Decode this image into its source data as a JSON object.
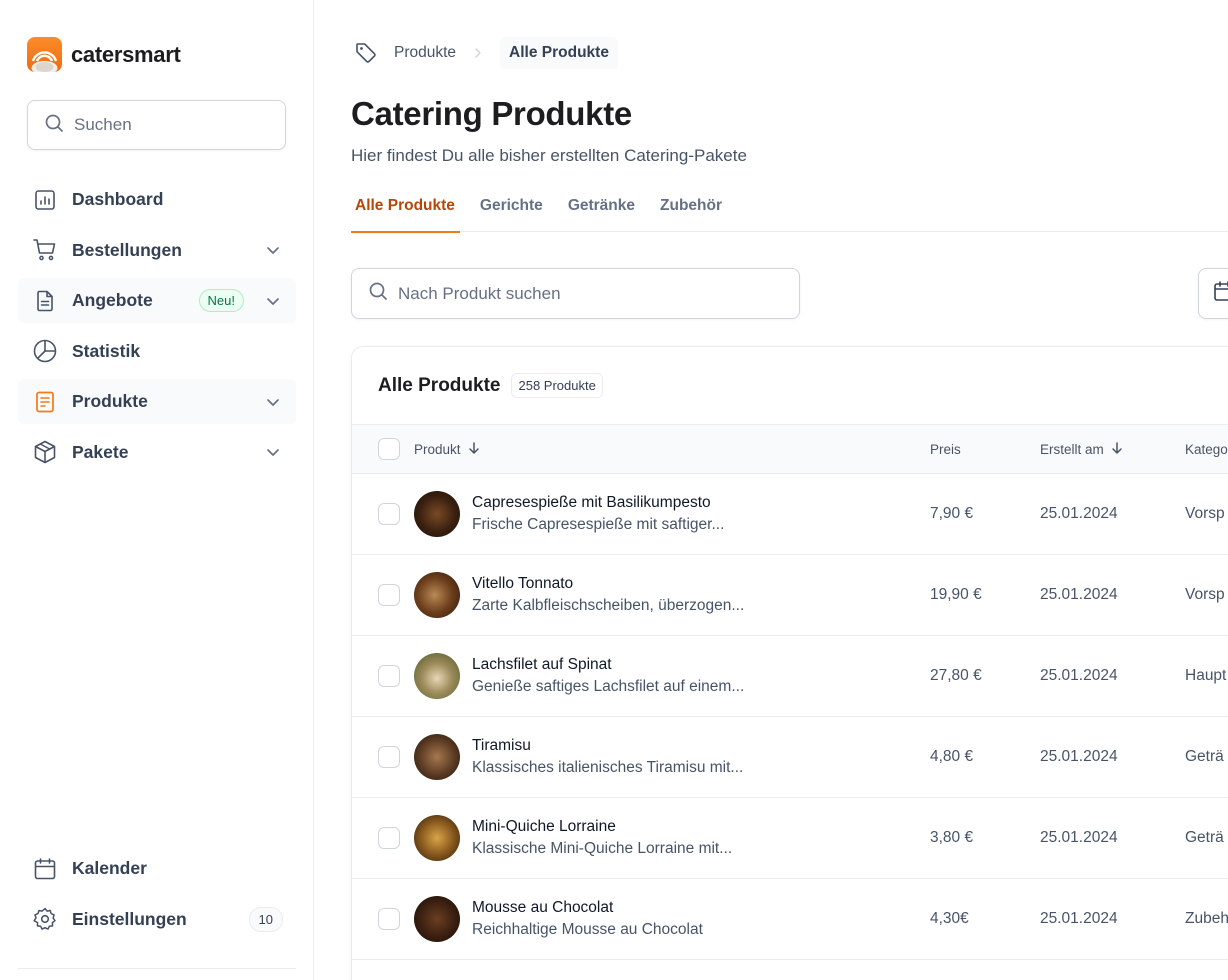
{
  "app": {
    "name": "catersmart"
  },
  "sidebar": {
    "search_placeholder": "Suchen",
    "items": [
      {
        "label": "Dashboard",
        "icon": "chart-bar-icon"
      },
      {
        "label": "Bestellungen",
        "icon": "cart-icon"
      },
      {
        "label": "Angebote",
        "icon": "document-icon",
        "badge": "Neu!"
      },
      {
        "label": "Statistik",
        "icon": "pie-chart-icon"
      },
      {
        "label": "Produkte",
        "icon": "product-doc-icon"
      },
      {
        "label": "Pakete",
        "icon": "package-icon"
      }
    ],
    "bottom_items": [
      {
        "label": "Kalender",
        "icon": "calendar-icon"
      },
      {
        "label": "Einstellungen",
        "icon": "gear-icon",
        "count": "10"
      }
    ]
  },
  "breadcrumb": {
    "parent": "Produkte",
    "current": "Alle Produkte"
  },
  "page": {
    "title": "Catering Produkte",
    "subtitle": "Hier findest Du alle bisher erstellten Catering-Pakete"
  },
  "tabs": [
    "Alle Produkte",
    "Gerichte",
    "Getränke",
    "Zubehör"
  ],
  "product_search": {
    "placeholder": "Nach Produkt suchen"
  },
  "table": {
    "title": "Alle Produkte",
    "count": "258 Produkte",
    "columns": {
      "product": "Produkt",
      "price": "Preis",
      "created": "Erstellt am",
      "category": "Katego"
    },
    "rows": [
      {
        "name": "Capresespieße mit Basilikumpesto",
        "desc": "Frische Capresespieße mit saftiger...",
        "price": "7,90 €",
        "date": "25.01.2024",
        "category": "Vorsp"
      },
      {
        "name": "Vitello Tonnato",
        "desc": "Zarte Kalbfleischscheiben, überzogen...",
        "price": "19,90 €",
        "date": "25.01.2024",
        "category": "Vorsp"
      },
      {
        "name": "Lachsfilet auf Spinat",
        "desc": "Genieße saftiges Lachsfilet auf einem...",
        "price": "27,80 €",
        "date": "25.01.2024",
        "category": "Haupt"
      },
      {
        "name": "Tiramisu",
        "desc": "Klassisches italienisches Tiramisu mit...",
        "price": "4,80 €",
        "date": "25.01.2024",
        "category": "Geträ"
      },
      {
        "name": "Mini-Quiche Lorraine",
        "desc": "Klassische Mini-Quiche Lorraine mit...",
        "price": "3,80 €",
        "date": "25.01.2024",
        "category": "Geträ"
      },
      {
        "name": "Mousse au Chocolat",
        "desc": "Reichhaltige Mousse au Chocolat",
        "price": "4,30€",
        "date": "25.01.2024",
        "category": "Zubeh"
      }
    ]
  },
  "colors": {
    "accent": "#f27a1a",
    "accent_text": "#b54708",
    "badge_green": "#067647"
  }
}
